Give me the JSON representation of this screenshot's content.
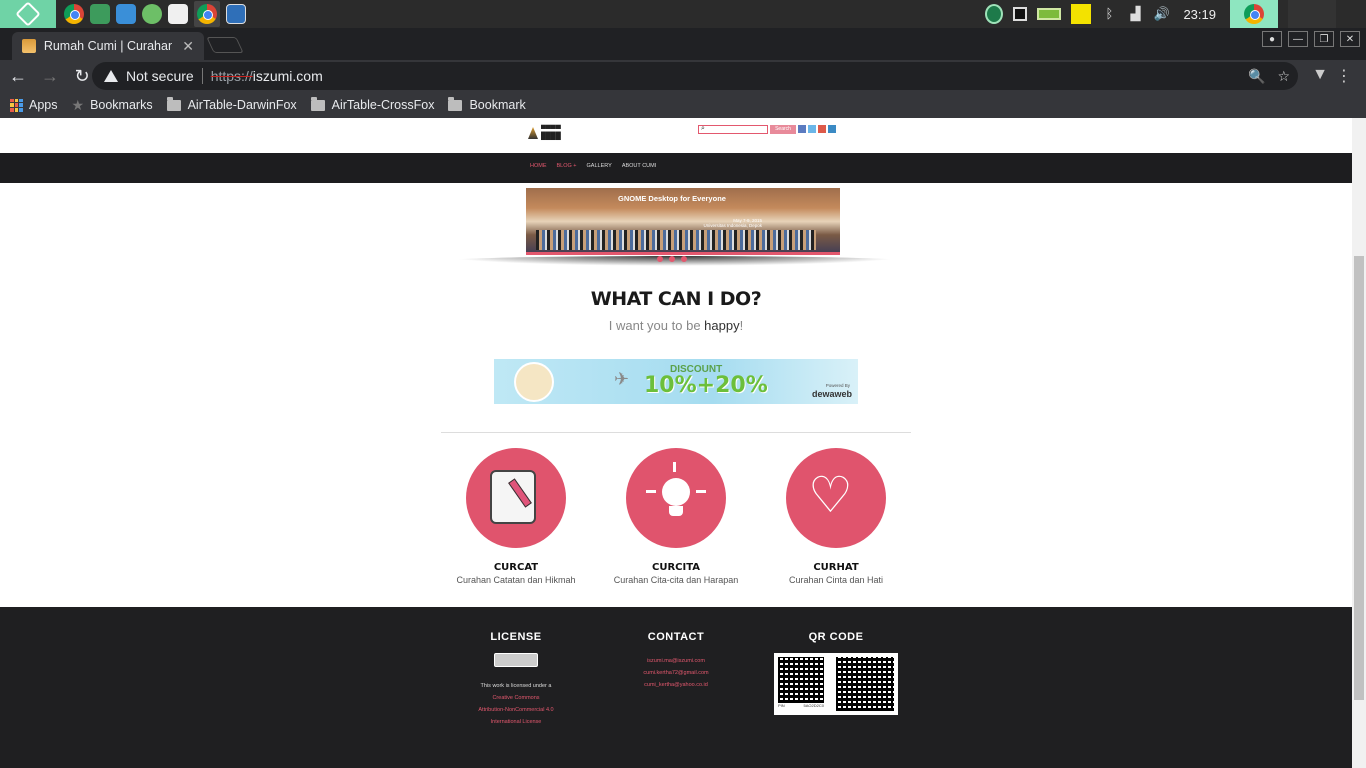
{
  "os": {
    "clock": "23:19"
  },
  "browser": {
    "tab_title": "Rumah Cumi | Curahan H",
    "security_label": "Not secure",
    "url_scheme": "https://",
    "url_host": "iszumi.com",
    "bookmarks": [
      "Apps",
      "Bookmarks",
      "AirTable-DarwinFox",
      "AirTable-CrossFox",
      "Bookmark"
    ]
  },
  "site": {
    "search_label": "Search",
    "nav": [
      "HOME",
      "BLOG +",
      "GALLERY",
      "ABOUT CUMI"
    ],
    "banner": {
      "title": "GNOME Desktop for Everyone",
      "date": "May 7-9, 2015",
      "venue": "Universitas Indonesia, Depok"
    },
    "heading": "WHAT CAN I DO?",
    "tagline_pre": "I want you to be ",
    "tagline_strong": "happy",
    "tagline_post": "!",
    "ad": {
      "label": "DISCOUNT",
      "value": "10%+20%",
      "powered": "Powered By",
      "brand": "dewaweb"
    },
    "features": [
      {
        "title": "CURCAT",
        "subtitle": "Curahan Catatan dan Hikmah",
        "icon": "notebook-pencil-icon"
      },
      {
        "title": "CURCITA",
        "subtitle": "Curahan Cita-cita dan Harapan",
        "icon": "lightbulb-icon"
      },
      {
        "title": "CURHAT",
        "subtitle": "Curahan Cinta dan Hati",
        "icon": "heart-icon"
      }
    ],
    "footer": {
      "license_heading": "LICENSE",
      "license_text": "This work is licensed under a",
      "license_link_1": "Creative Commons",
      "license_link_2": "Attribution-NonCommercial 4.0",
      "license_link_3": "International License",
      "contact_heading": "CONTACT",
      "contacts": [
        "iszumi.ma@iszumi.com",
        "cumi.kertha72@gmail.com",
        "cumi_kertha@yahoo.co.id"
      ],
      "qr_heading": "QR CODE",
      "qr_pin_label": "PIN",
      "qr_pin_value": "5AO2D2C0"
    }
  },
  "colors": {
    "accent": "#e0546d",
    "footer_bg": "#1f1f21",
    "nav_bg": "#1d1d1f"
  }
}
